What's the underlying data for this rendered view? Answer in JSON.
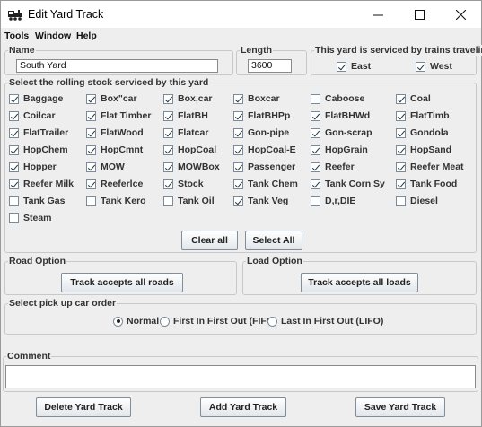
{
  "window": {
    "title": "Edit Yard Track",
    "icon": "locomotive-icon"
  },
  "menu": [
    "Tools",
    "Window",
    "Help"
  ],
  "name_panel": {
    "label": "Name",
    "value": "South Yard"
  },
  "length_panel": {
    "label": "Length",
    "value": "3600"
  },
  "direction_panel": {
    "label": "This yard is serviced by trains traveling",
    "options": [
      {
        "label": "East",
        "checked": true
      },
      {
        "label": "West",
        "checked": true
      }
    ]
  },
  "rolling_stock": {
    "label": "Select the rolling stock serviced by this yard",
    "types": [
      {
        "label": "Baggage",
        "checked": true
      },
      {
        "label": "Box\"car",
        "checked": true
      },
      {
        "label": "Box,car",
        "checked": true
      },
      {
        "label": "Boxcar",
        "checked": true
      },
      {
        "label": "Caboose",
        "checked": false
      },
      {
        "label": "Coal",
        "checked": true
      },
      {
        "label": "Coilcar",
        "checked": true
      },
      {
        "label": "Flat Timber",
        "checked": true
      },
      {
        "label": "FlatBH",
        "checked": true
      },
      {
        "label": "FlatBHPp",
        "checked": true
      },
      {
        "label": "FlatBHWd",
        "checked": true
      },
      {
        "label": "FlatTimb",
        "checked": true
      },
      {
        "label": "FlatTrailer",
        "checked": true
      },
      {
        "label": "FlatWood",
        "checked": true
      },
      {
        "label": "Flatcar",
        "checked": true
      },
      {
        "label": "Gon-pipe",
        "checked": true
      },
      {
        "label": "Gon-scrap",
        "checked": true
      },
      {
        "label": "Gondola",
        "checked": true
      },
      {
        "label": "HopChem",
        "checked": true
      },
      {
        "label": "HopCmnt",
        "checked": true
      },
      {
        "label": "HopCoal",
        "checked": true
      },
      {
        "label": "HopCoal-E",
        "checked": true
      },
      {
        "label": "HopGrain",
        "checked": true
      },
      {
        "label": "HopSand",
        "checked": true
      },
      {
        "label": "Hopper",
        "checked": true
      },
      {
        "label": "MOW",
        "checked": true
      },
      {
        "label": "MOWBox",
        "checked": true
      },
      {
        "label": "Passenger",
        "checked": true
      },
      {
        "label": "Reefer",
        "checked": true
      },
      {
        "label": "Reefer Meat",
        "checked": true
      },
      {
        "label": "Reefer Milk",
        "checked": true
      },
      {
        "label": "Reeferlce",
        "checked": true
      },
      {
        "label": "Stock",
        "checked": true
      },
      {
        "label": "Tank Chem",
        "checked": true
      },
      {
        "label": "Tank Corn Sy",
        "checked": true
      },
      {
        "label": "Tank Food",
        "checked": true
      },
      {
        "label": "Tank Gas",
        "checked": false
      },
      {
        "label": "Tank Kero",
        "checked": false
      },
      {
        "label": "Tank Oil",
        "checked": false
      },
      {
        "label": "Tank Veg",
        "checked": true
      },
      {
        "label": "D,r,DIE",
        "checked": false
      },
      {
        "label": "Diesel",
        "checked": false
      },
      {
        "label": "Steam",
        "checked": false
      }
    ],
    "clear_all_label": "Clear all",
    "select_all_label": "Select All"
  },
  "road_option": {
    "label": "Road Option",
    "button": "Track accepts all roads"
  },
  "load_option": {
    "label": "Load Option",
    "button": "Track accepts all loads"
  },
  "pickup_order": {
    "label": "Select pick up car order",
    "options": [
      {
        "label": "Normal",
        "selected": true
      },
      {
        "label": "First In First Out (FIFO)",
        "selected": false
      },
      {
        "label": "Last In First Out (LIFO)",
        "selected": false
      }
    ]
  },
  "comment": {
    "label": "Comment",
    "value": ""
  },
  "actions": {
    "delete_label": "Delete Yard Track",
    "add_label": "Add Yard Track",
    "save_label": "Save Yard Track"
  }
}
